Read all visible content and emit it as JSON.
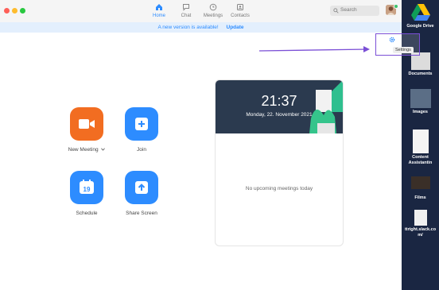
{
  "nav": {
    "home": "Home",
    "chat": "Chat",
    "meetings": "Meetings",
    "contacts": "Contacts"
  },
  "search": {
    "placeholder": "Search"
  },
  "banner": {
    "message": "A new version is available!",
    "update": "Update"
  },
  "actions": {
    "new_meeting": "New Meeting",
    "join": "Join",
    "schedule": "Schedule",
    "schedule_day": "19",
    "share_screen": "Share Screen"
  },
  "meetings_card": {
    "time": "21:37",
    "date": "Monday, 22. November 2021",
    "empty": "No upcoming meetings today"
  },
  "settings": {
    "tooltip": "Settings"
  },
  "desktop": {
    "google_drive": "Google Drive",
    "documents": "Documents",
    "images": "Images",
    "content_line1": "Content",
    "content_line2": "Assistantin",
    "films": "Films",
    "slack_line1": "ttright.slack.co",
    "slack_line2": "m/"
  },
  "colors": {
    "accent": "#2d8cff",
    "orange": "#f26d21",
    "highlight": "#7b4fd6"
  }
}
